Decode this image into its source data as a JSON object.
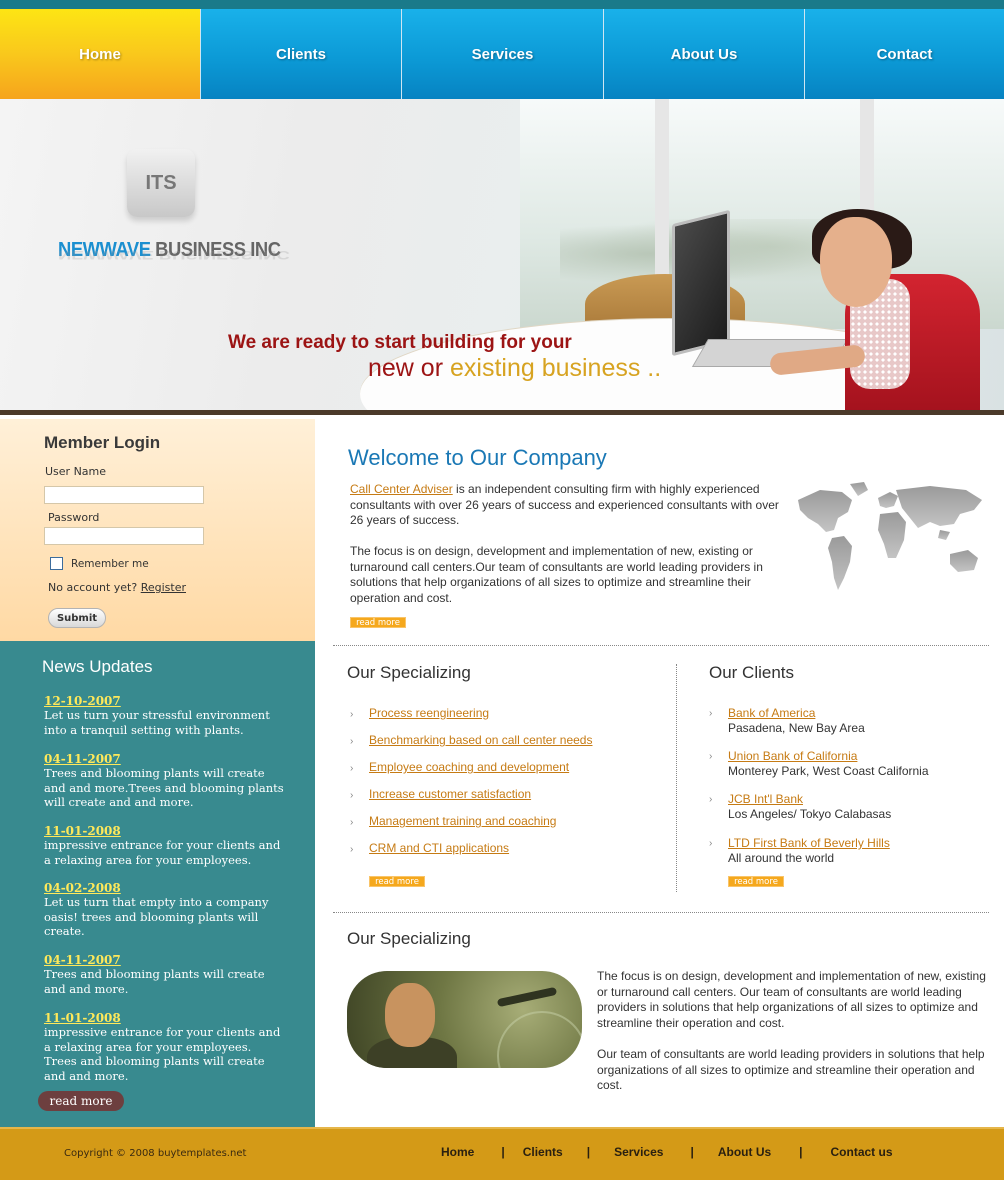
{
  "nav": {
    "tabs": [
      {
        "label": "Home",
        "active": true
      },
      {
        "label": "Clients",
        "active": false
      },
      {
        "label": "Services",
        "active": false
      },
      {
        "label": "About Us",
        "active": false
      },
      {
        "label": "Contact",
        "active": false
      }
    ]
  },
  "banner": {
    "logo_badge": "ITS",
    "logo_name_part1": "NEWWAVE",
    "logo_name_part2": " BUSINESS INC",
    "tagline_line1": "We are ready to start building for your",
    "tagline_new": "new or ",
    "tagline_existing": "existing business .."
  },
  "login": {
    "title": "Member Login",
    "username_label": "User Name",
    "username_value": "",
    "password_label": "Password",
    "password_value": "",
    "remember_label": "Remember me",
    "remember_checked": false,
    "no_account_text": "No account yet? ",
    "register_label": "Register",
    "submit_label": "Submit"
  },
  "news": {
    "title": "News Updates",
    "items": [
      {
        "date": "12-10-2007",
        "text": "Let us turn your stressful environment into a tranquil setting with plants."
      },
      {
        "date": "04-11-2007",
        "text": "Trees and blooming plants will create and and more.Trees and blooming plants will create and and more."
      },
      {
        "date": "11-01-2008",
        "text": "impressive entrance for your clients and a relaxing area for your employees."
      },
      {
        "date": "04-02-2008",
        "text": "Let us turn that empty into a company oasis! trees and blooming plants will create."
      },
      {
        "date": "04-11-2007",
        "text": "Trees and blooming plants will create and and more."
      },
      {
        "date": "11-01-2008",
        "text": "impressive entrance for your clients and a relaxing area for your employees. Trees and blooming plants will create and and more."
      }
    ],
    "read_more": "read more"
  },
  "welcome": {
    "title": "Welcome to Our Company",
    "para1_link": "Call Center Adviser",
    "para1_text": " is an independent consulting firm with highly experienced consultants with over 26 years of success and experienced consultants with over 26 years of success.",
    "para2": "The focus is on design, development and implementation of new, existing or turnaround call centers.Our team of consultants are world leading providers in solutions that help organizations of all sizes to optimize and streamline their operation and cost.",
    "read_more": "read more"
  },
  "specializing": {
    "title": "Our Specializing",
    "items": [
      "Process reengineering",
      "Benchmarking based on call center needs",
      "Employee coaching and development",
      "Increase customer satisfaction",
      "Management training and coaching",
      "CRM and CTI applications"
    ],
    "read_more": "read more"
  },
  "clients": {
    "title": "Our Clients",
    "items": [
      {
        "name": "Bank of America",
        "location": "Pasadena, New Bay Area"
      },
      {
        "name": "Union Bank of California",
        "location": "Monterey Park, West Coast California"
      },
      {
        "name": "JCB Int'l Bank",
        "location": "Los Angeles/ Tokyo  Calabasas"
      },
      {
        "name": "LTD First Bank of Beverly Hills",
        "location": "All around the world"
      }
    ],
    "read_more": "read more"
  },
  "specializing2": {
    "title": "Our Specializing",
    "para1": "The focus is on design, development and implementation of new, existing or turnaround call centers. Our team of consultants are world leading providers in solutions that help organizations of all sizes to optimize and streamline their operation and cost.",
    "para2": "Our team of consultants are world leading providers in solutions that help organizations of all sizes to optimize and streamline their operation and cost."
  },
  "footer": {
    "copyright": "Copyright © 2008 buytemplates.net",
    "links": [
      "Home",
      "Clients",
      "Services",
      "About Us",
      "Contact us"
    ],
    "separator": "|"
  },
  "colors": {
    "nav_blue": "#0c9ad6",
    "nav_active": "#f9c81c",
    "news_bg": "#388a8f",
    "link_orange": "#c67b14",
    "title_blue": "#1a78b5",
    "footer_bg": "#d49a17"
  }
}
